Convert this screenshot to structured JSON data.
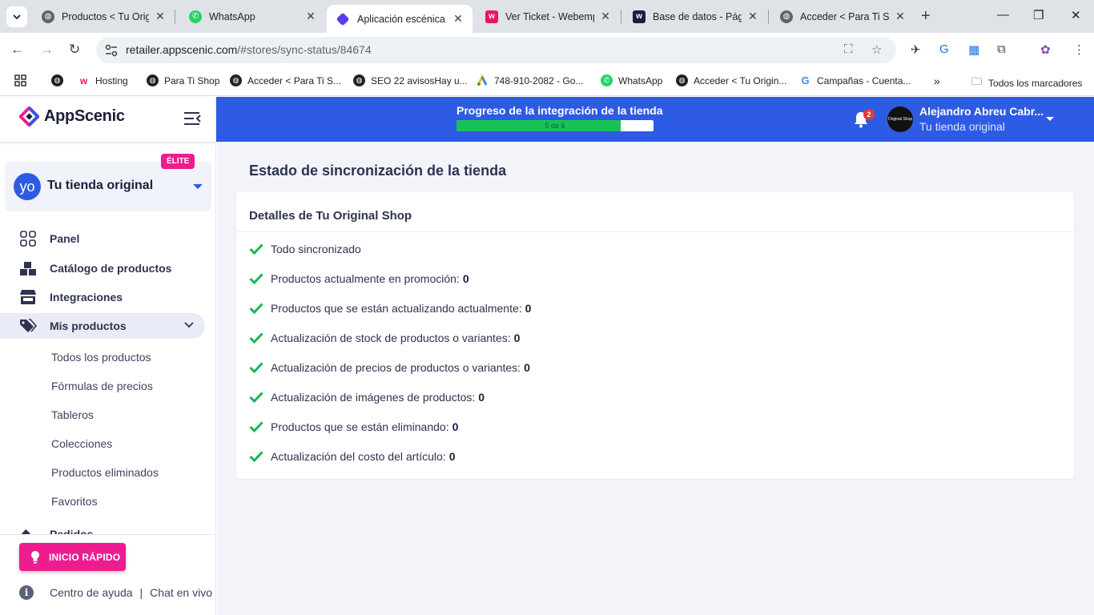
{
  "browser": {
    "tabs": [
      {
        "title": "Productos < Tu Origi",
        "icon_color": "#5f6368",
        "icon": "globe-icon"
      },
      {
        "title": "WhatsApp",
        "icon_color": "#25d366",
        "icon": "whatsapp-icon"
      },
      {
        "title": "Aplicación escénica",
        "icon_color": "#5b3df5",
        "icon": "appscenic-icon",
        "active": true
      },
      {
        "title": "Ver Ticket - Webempr",
        "icon_color": "#e8175d",
        "icon": "webempresa-icon"
      },
      {
        "title": "Base de datos - Págin",
        "icon_color": "#1b1f3b",
        "icon": "webempresa-w-icon"
      },
      {
        "title": "Acceder < Para Ti Sho",
        "icon_color": "#5f6368",
        "icon": "globe-icon"
      }
    ],
    "url_host": "retailer.appscenic.com",
    "url_path": "/#stores/sync-status/84674",
    "bookmarks": [
      {
        "label": "",
        "icon": "globe-icon",
        "color": "#202124"
      },
      {
        "label": "Hosting",
        "icon": "webempresa-icon",
        "color": "#e8175d"
      },
      {
        "label": "Para Ti Shop",
        "icon": "globe-icon",
        "color": "#202124"
      },
      {
        "label": "Acceder < Para Ti S...",
        "icon": "globe-icon",
        "color": "#202124"
      },
      {
        "label": "SEO 22 avisosHay u...",
        "icon": "globe-icon",
        "color": "#202124"
      },
      {
        "label": "748-910-2082 - Go...",
        "icon": "google-ads-icon",
        "color": "#fbbc04"
      },
      {
        "label": "WhatsApp",
        "icon": "whatsapp-icon",
        "color": "#25d366"
      },
      {
        "label": "Acceder < Tu Origin...",
        "icon": "globe-icon",
        "color": "#202124"
      },
      {
        "label": "Campañas - Cuenta...",
        "icon": "google-icon",
        "color": "#4285f4"
      }
    ],
    "all_bookmarks": "Todos los marcadores"
  },
  "app": {
    "brand": "AppScenic",
    "store": {
      "avatar_text": "yo",
      "name": "Tu tienda original",
      "badge": "ÉLITE"
    },
    "nav": [
      {
        "label": "Panel",
        "icon": "dashboard-icon"
      },
      {
        "label": "Catálogo de productos",
        "icon": "boxes-icon"
      },
      {
        "label": "Integraciones",
        "icon": "store-icon"
      },
      {
        "label": "Mis productos",
        "icon": "tags-icon",
        "open": true
      }
    ],
    "subnav": [
      "Todos los productos",
      "Fórmulas de precios",
      "Tableros",
      "Colecciones",
      "Productos eliminados",
      "Favoritos"
    ],
    "nav_cut": "Pedidos",
    "quick_start": "INICIO RÁPIDO",
    "help": "Centro de ayuda",
    "help_sep": "|",
    "chat": "Chat en vivo"
  },
  "topbar": {
    "progress_title": "Progreso de la integración de la tienda",
    "progress_text": "5 de 6",
    "progress_value": 0.833,
    "notifications": "2",
    "user_name": "Alejandro Abreu Cabr...",
    "user_store": "Tu tienda original",
    "avatar_text": "Original Shop"
  },
  "page": {
    "title": "Estado de sincronización de la tienda",
    "card_title": "Detalles de Tu Original Shop",
    "rows": [
      {
        "label": "Todo sincronizado",
        "value": ""
      },
      {
        "label": "Productos actualmente en promoción:",
        "value": "0"
      },
      {
        "label": "Productos que se están actualizando actualmente:",
        "value": "0"
      },
      {
        "label": "Actualización de stock de productos o variantes:",
        "value": "0"
      },
      {
        "label": "Actualización de precios de productos o variantes:",
        "value": "0"
      },
      {
        "label": "Actualización de imágenes de productos:",
        "value": "0"
      },
      {
        "label": "Productos que se están eliminando:",
        "value": "0"
      },
      {
        "label": "Actualización del costo del artículo:",
        "value": "0"
      }
    ]
  },
  "colors": {
    "brand_blue": "#2d5be3",
    "accent_pink": "#ee1c8f",
    "check_green": "#17b65a"
  }
}
